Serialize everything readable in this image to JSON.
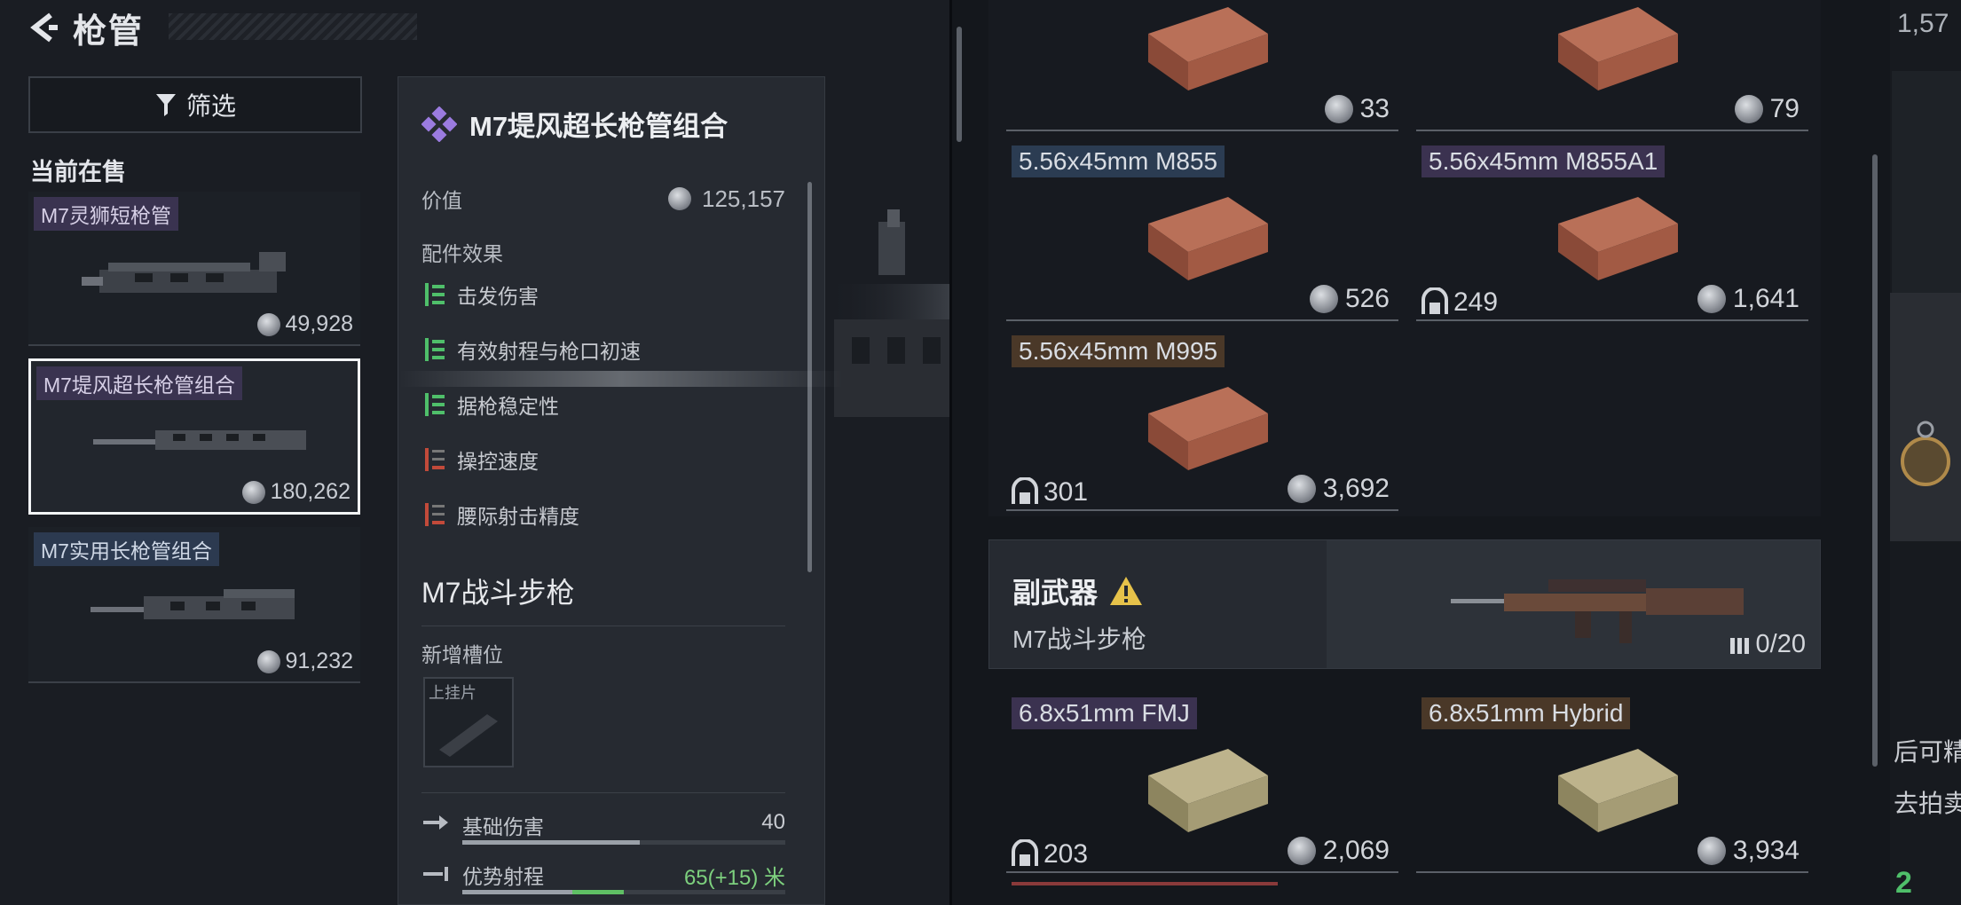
{
  "header": {
    "title": "枪管"
  },
  "filter": {
    "label": "筛选"
  },
  "current_sale_label": "当前在售",
  "items": [
    {
      "name": "M7灵狮短枪管",
      "price": "49,928"
    },
    {
      "name": "M7堤风超长枪管组合",
      "price": "180,262"
    },
    {
      "name": "M7实用长枪管组合",
      "price": "91,232"
    }
  ],
  "detail": {
    "title": "M7堤风超长枪管组合",
    "value_label": "价值",
    "value": "125,157",
    "effects_label": "配件效果",
    "effects": [
      {
        "label": "击发伤害",
        "type": "positive"
      },
      {
        "label": "有效射程与枪口初速",
        "type": "positive"
      },
      {
        "label": "据枪稳定性",
        "type": "positive"
      },
      {
        "label": "操控速度",
        "type": "negative"
      },
      {
        "label": "腰际射击精度",
        "type": "negative"
      }
    ],
    "weapon_name": "M7战斗步枪",
    "new_slot_label": "新增槽位",
    "slot_name": "上挂片",
    "stats": [
      {
        "label": "基础伤害",
        "value": "40",
        "highlight": false,
        "fill": 0.55
      },
      {
        "label": "优势射程",
        "value": "65(+15) 米",
        "highlight": true,
        "fill": 0.5
      }
    ]
  },
  "ammo": [
    {
      "name": "",
      "price": "33",
      "trade": ""
    },
    {
      "name": "",
      "price": "79",
      "trade": ""
    },
    {
      "name": "5.56x45mm M855",
      "price": "526",
      "trade": "",
      "color": "blue"
    },
    {
      "name": "5.56x45mm M855A1",
      "price": "1,641",
      "trade": "249",
      "color": "purple"
    },
    {
      "name": "5.56x45mm M995",
      "price": "3,692",
      "trade": "301",
      "color": "brown"
    }
  ],
  "secondary": {
    "title": "副武器",
    "weapon": "M7战斗步枪",
    "ammo_count": "0/20"
  },
  "ammo2": [
    {
      "name": "6.8x51mm FMJ",
      "price": "2,069",
      "trade": "203",
      "color": "purple"
    },
    {
      "name": "6.8x51mm Hybrid",
      "price": "3,934",
      "trade": "",
      "color": "brown"
    }
  ],
  "right": {
    "number": "1,57",
    "text1": "后可精",
    "text2": "去拍卖",
    "green": "2"
  },
  "colors": {
    "accent_purple": "#8e6bd6",
    "positive": "#4fbf6a",
    "negative": "#c24a3a",
    "selected_border": "#f2f4f6"
  }
}
